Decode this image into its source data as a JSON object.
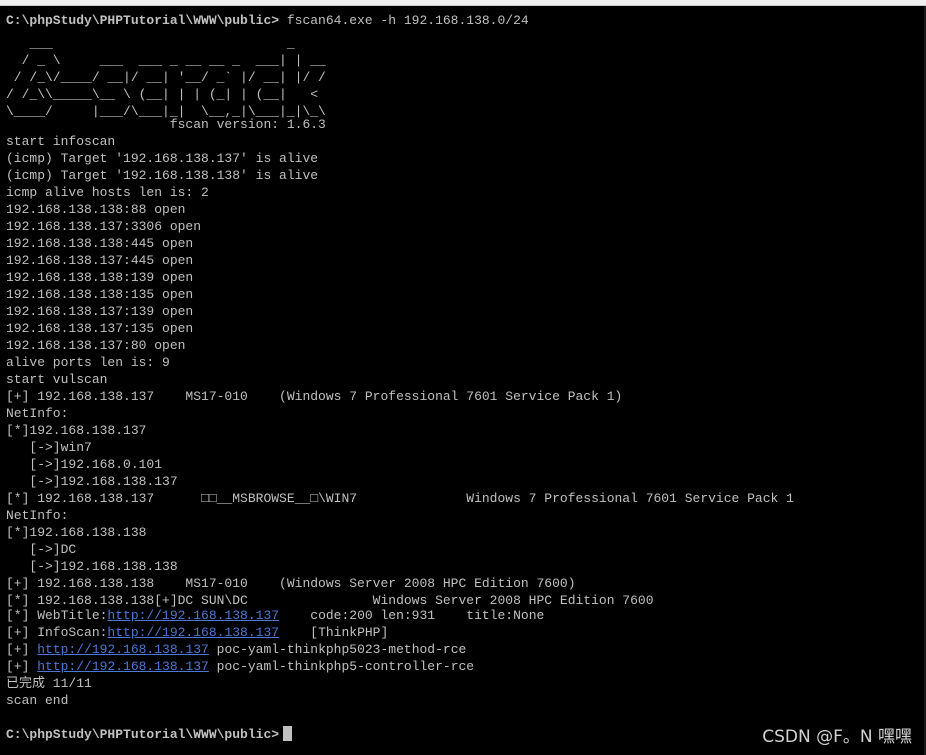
{
  "terminal": {
    "prompt_path": "C:\\phpStudy\\PHPTutorial\\WWW\\public>",
    "command": " fscan64.exe -h 192.168.138.0/24",
    "banner": "   ___                              _\n  / _ \\     ___  ___ _ __ __ _  ___| | __\n / /_\\/____/ __|/ __| '__/ _` |/ __| |/ /\n/ /_\\\\_____\\__ \\ (__| | | (_| | (__|   <\n\\____/     |___/\\___|_|  \\__,_|\\___|_|\\_\\",
    "version_line": "                     fscan version: 1.6.3",
    "lines": [
      "start infoscan",
      "(icmp) Target '192.168.138.137' is alive",
      "(icmp) Target '192.168.138.138' is alive",
      "icmp alive hosts len is: 2",
      "192.168.138.138:88 open",
      "192.168.138.137:3306 open",
      "192.168.138.138:445 open",
      "192.168.138.137:445 open",
      "192.168.138.138:139 open",
      "192.168.138.138:135 open",
      "192.168.138.137:139 open",
      "192.168.138.137:135 open",
      "192.168.138.137:80 open",
      "alive ports len is: 9",
      "start vulscan",
      "[+] 192.168.138.137    MS17-010    (Windows 7 Professional 7601 Service Pack 1)",
      "NetInfo:",
      "[*]192.168.138.137",
      "   [->]win7",
      "   [->]192.168.0.101",
      "   [->]192.168.138.137",
      "[*] 192.168.138.137      □□__MSBROWSE__□\\WIN7              Windows 7 Professional 7601 Service Pack 1",
      "NetInfo:",
      "[*]192.168.138.138",
      "   [->]DC",
      "   [->]192.168.138.138",
      "[+] 192.168.138.138    MS17-010    (Windows Server 2008 HPC Edition 7600)",
      "[*] 192.168.138.138[+]DC SUN\\DC                Windows Server 2008 HPC Edition 7600"
    ],
    "webtitle": {
      "prefix": "[*] WebTitle:",
      "url": "http://192.168.138.137",
      "suffix": "    code:200 len:931    title:None"
    },
    "infoscan": {
      "prefix": "[+] InfoScan:",
      "url": "http://192.168.138.137",
      "suffix": "    [ThinkPHP]"
    },
    "poc1": {
      "prefix": "[+] ",
      "url": "http://192.168.138.137",
      "suffix": " poc-yaml-thinkphp5023-method-rce"
    },
    "poc2": {
      "prefix": "[+] ",
      "url": "http://192.168.138.137",
      "suffix": " poc-yaml-thinkphp5-controller-rce"
    },
    "done_line": "已完成 11/11",
    "end_line": "scan end",
    "final_prompt": "C:\\phpStudy\\PHPTutorial\\WWW\\public>"
  },
  "watermark": "CSDN @F。N 嘿嘿",
  "colors": {
    "background": "#000000",
    "text": "#c0c0c0",
    "link": "#4a78d6"
  }
}
